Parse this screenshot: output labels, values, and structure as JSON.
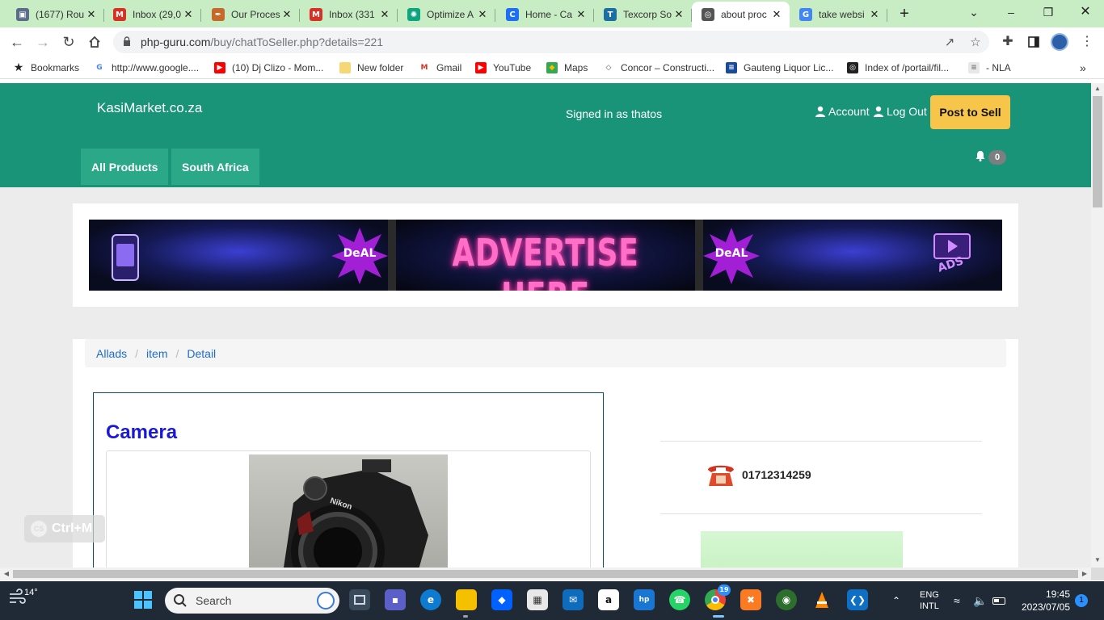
{
  "browser": {
    "tabs": [
      {
        "title": "(1677) Rou",
        "icon": "cube-icon",
        "color": "#5b6b8a"
      },
      {
        "title": "Inbox (29,0",
        "icon": "gmail-icon",
        "color": "#d93025"
      },
      {
        "title": "Our Proces",
        "icon": "pen-icon",
        "color": "#c56a2a"
      },
      {
        "title": "Inbox (331",
        "icon": "gmail-icon",
        "color": "#d93025"
      },
      {
        "title": "Optimize A",
        "icon": "openai-icon",
        "color": "#10a37f"
      },
      {
        "title": "Home - Ca",
        "icon": "canva-icon",
        "color": "#1f6ff5"
      },
      {
        "title": "Texcorp So",
        "icon": "texcorp-icon",
        "color": "#1b6fa3"
      },
      {
        "title": "about proc",
        "icon": "globe-icon",
        "color": "#555555"
      },
      {
        "title": "take websi",
        "icon": "google-icon",
        "color": "#4285f4"
      }
    ],
    "active_tab_index": 7,
    "url_host": "php-guru.com",
    "url_path": "/buy/chatToSeller.php?details=221",
    "bookmarks": [
      {
        "label": "Bookmarks",
        "icon": "star-icon"
      },
      {
        "label": "http://www.google....",
        "icon": "google-icon"
      },
      {
        "label": "(10) Dj Clizo - Mom...",
        "icon": "youtube-icon"
      },
      {
        "label": "New folder",
        "icon": "folder-icon"
      },
      {
        "label": "Gmail",
        "icon": "gmail-icon"
      },
      {
        "label": "YouTube",
        "icon": "youtube-icon"
      },
      {
        "label": "Maps",
        "icon": "maps-icon"
      },
      {
        "label": "Concor – Constructi...",
        "icon": "concor-icon"
      },
      {
        "label": "Gauteng Liquor Lic...",
        "icon": "sa-gov-icon"
      },
      {
        "label": "Index of /portail/fil...",
        "icon": "globe-icon"
      },
      {
        "label": "- NLA",
        "icon": "doc-icon"
      }
    ]
  },
  "site": {
    "brand": "KasiMarket.co.za",
    "signed_in": "Signed in as thatos",
    "account_label": "Account",
    "logout_label": "Log Out",
    "post_label": "Post to Sell",
    "nav": [
      "All Products",
      "South Africa"
    ],
    "notification_count": "0",
    "ad_text": "ADVERTISE HERE",
    "ad_badge": "DeAL",
    "ad_corner": "ADS",
    "breadcrumbs": [
      "Allads",
      "item",
      "Detail"
    ],
    "item_title": "Camera",
    "camera_brand": "Nikon",
    "phone": "01712314259",
    "overlay_hint": "Ctrl+M",
    "overlay_logo": "CS"
  },
  "taskbar": {
    "weather": "14°",
    "search_placeholder": "Search",
    "lang_top": "ENG",
    "lang_bottom": "INTL",
    "time": "19:45",
    "date": "2023/07/05",
    "notifications": "1",
    "chrome_badge": "19"
  },
  "colors": {
    "header": "#1a9478",
    "nav_button": "#2aa888",
    "post_button": "#f7c54a",
    "item_title": "#1919d6",
    "link": "#1e6ccc"
  }
}
